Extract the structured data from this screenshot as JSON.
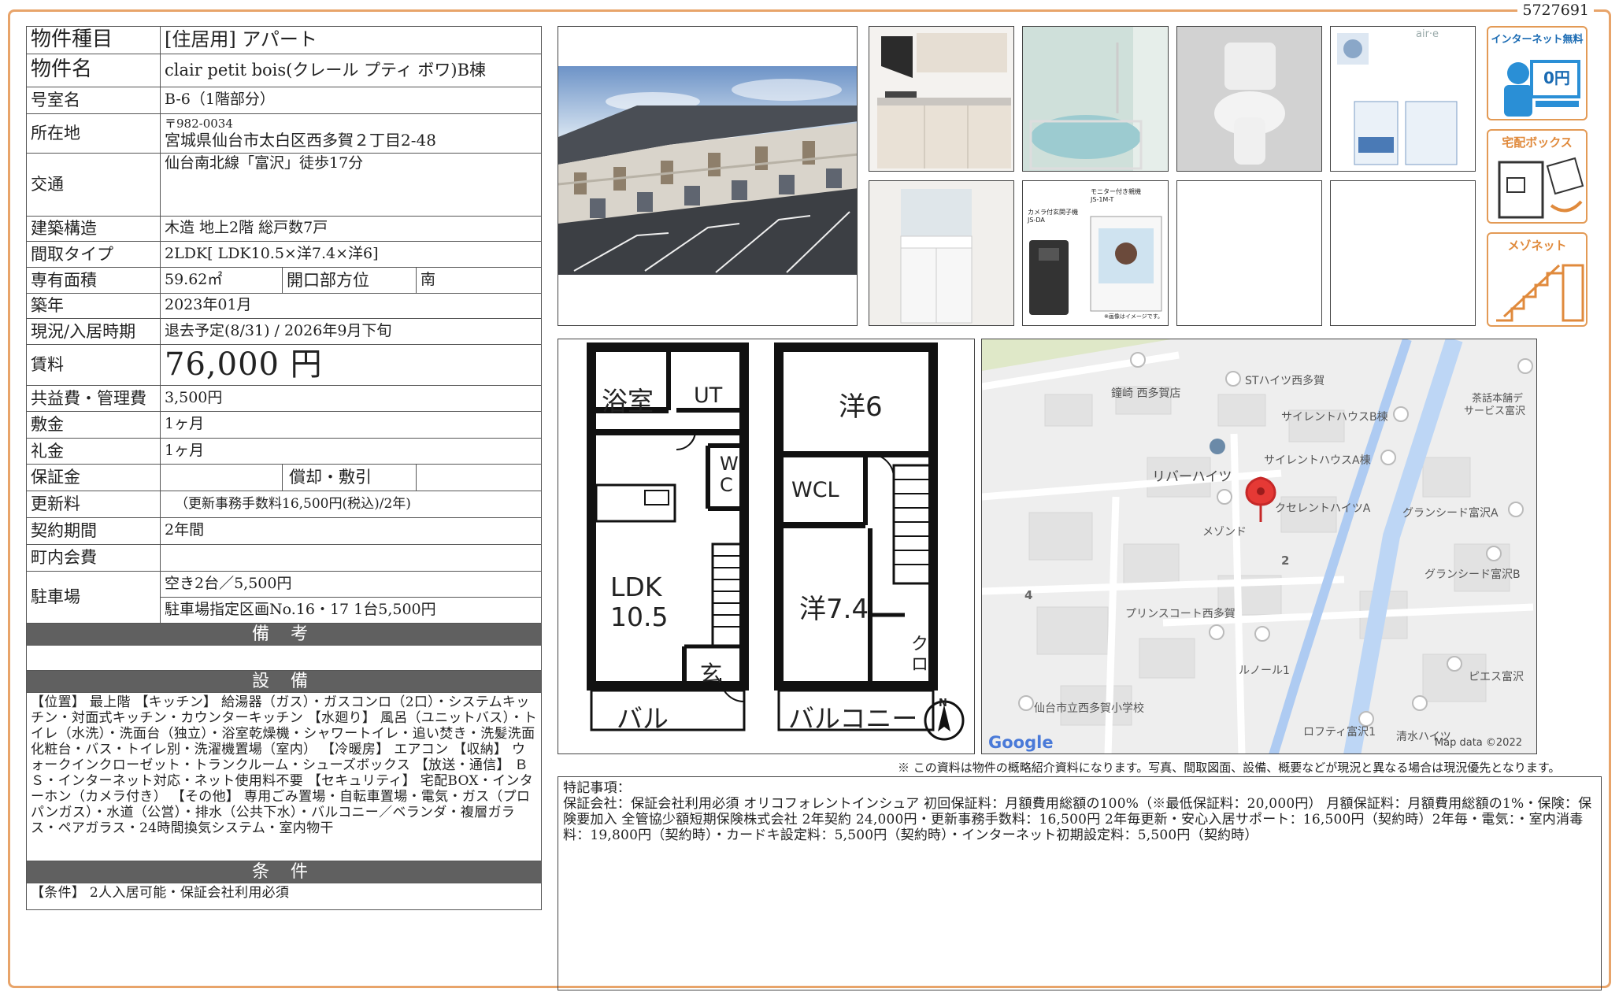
{
  "doc_id": "5727691",
  "rows": {
    "type": {
      "label": "物件種目",
      "value": "[住居用]  アパート"
    },
    "name": {
      "label": "物件名",
      "value": "clair petit bois(クレール プティ ボワ)B棟"
    },
    "room": {
      "label": "号室名",
      "value": "B-6（1階部分）"
    },
    "address": {
      "label": "所在地",
      "zip": "〒982-0034",
      "value": "宮城県仙台市太白区西多賀２丁目2-48"
    },
    "access": {
      "label": "交通",
      "value": "仙台南北線「富沢」徒歩17分"
    },
    "structure": {
      "label": "建築構造",
      "value": "木造  地上2階  総戸数7戸"
    },
    "layout": {
      "label": "間取タイプ",
      "value": "2LDK[ LDK10.5×洋7.4×洋6]"
    },
    "area": {
      "label": "専有面積",
      "value": "59.62㎡",
      "label2": "開口部方位",
      "value2": "南"
    },
    "built": {
      "label": "築年",
      "value": "2023年01月"
    },
    "status": {
      "label": "現況/入居時期",
      "value": "退去予定(8/31)  /  2026年9月下旬"
    },
    "rent": {
      "label": "賃料",
      "value": "76,000 円"
    },
    "fee": {
      "label": "共益費・管理費",
      "value": "3,500円"
    },
    "deposit": {
      "label": "敷金",
      "value": "1ヶ月"
    },
    "keymoney": {
      "label": "礼金",
      "value": "1ヶ月"
    },
    "guarantee": {
      "label": "保証金",
      "value": "",
      "label2": "償却・敷引",
      "value2": ""
    },
    "renewal": {
      "label": "更新料",
      "value": "（更新事務手数料16,500円(税込)/2年)"
    },
    "term": {
      "label": "契約期間",
      "value": "2年間"
    },
    "town": {
      "label": "町内会費",
      "value": ""
    },
    "parking": {
      "label": "駐車場",
      "value": "空き2台／5,500円",
      "value_b": "駐車場指定区画No.16・17    1台5,500円"
    }
  },
  "sections": {
    "remarks": "備 考",
    "equipment": "設 備",
    "conditions": "条 件"
  },
  "equipment_text": "【位置】 最上階 【キッチン】 給湯器（ガス）・ガスコンロ（2口）・システムキッチン・対面式キッチン・カウンターキッチン 【水廻り】 風呂（ユニットバス）・トイレ（水洗）・洗面台（独立）・浴室乾燥機・シャワートイレ・追い焚き・洗髪洗面化粧台・バス・トイレ別・洗濯機置場（室内） 【冷暖房】 エアコン 【収納】 ウォークインクローゼット・トランクルーム・シューズボックス 【放送・通信】 ＢＳ・インターネット対応・ネット使用料不要 【セキュリティ】 宅配BOX・インターホン（カメラ付き） 【その他】 専用ごみ置場・自転車置場・電気・ガス（プロパンガス）・水道（公営）・排水（公共下水）・バルコニー／ベランダ・複層ガラス・ペアガラス・24時間換気システム・室内物干",
  "conditions_text": "【条件】 2人入居可能・保証会社利用必須",
  "badges": {
    "internet": "インターネット無料",
    "internet_sub": "0円",
    "delivery": "宅配ボックス",
    "maisonette": "メゾネット"
  },
  "photo_text": {
    "brand": "air·e",
    "intercom_title": "モニター付き親機",
    "intercom_model": "JS-1M-T",
    "intercom_cam": "カメラ付玄関子機",
    "intercom_cam_model": "JS-DA",
    "intercom_note": "※画像はイメージです。"
  },
  "floorplan": {
    "bath": "浴室",
    "ut": "UT",
    "wc": "W C",
    "ldk": "LDK",
    "ldk_size": "10.5",
    "entrance": "玄",
    "balcony1": "バル",
    "western6": "洋6",
    "wcl": "WCL",
    "western74": "洋7.4",
    "closet": "ク ロ",
    "balcony2": "バルコニー",
    "north": "N"
  },
  "map": {
    "labels": [
      "鐘崎 西多賀店",
      "STハイツ西多賀",
      "サイレントハウスB棟",
      "サイレントハウスA棟",
      "リバーハイツ",
      "クセレントハイツA",
      "グランシード富沢A",
      "メゾンド",
      "グランシード富沢B",
      "プリンスコート西多賀",
      "ルノール1",
      "ピエス富沢",
      "仙台市立西多賀小学校",
      "ロフティ富沢1",
      "清水ハイツ",
      "茶話本舗デ",
      "サービス富沢"
    ],
    "numbers": [
      "2",
      "4"
    ],
    "logo": "Google",
    "credit": "Map data ©2022"
  },
  "notice": "※ この資料は物件の概略紹介資料になります。写真、間取図面、設備、概要などが現況と異なる場合は現況優先となります。",
  "notes": {
    "title": "特記事項：",
    "body": "保証会社：保証会社利用必須 オリコフォレントインシュア 初回保証料：月額費用総額の100%（※最低保証料：20,000円） 月額保証料：月額費用総額の1%・保険：保険要加入 全管協少額短期保険株式会社 2年契約 24,000円・更新事務手数料：16,500円 2年毎更新・安心入居サポート：16,500円（契約時）2年毎・電気：・室内消毒料：19,800円（契約時）・カードキ設定料：5,500円（契約時）・インターネット初期設定料：5,500円（契約時）"
  }
}
